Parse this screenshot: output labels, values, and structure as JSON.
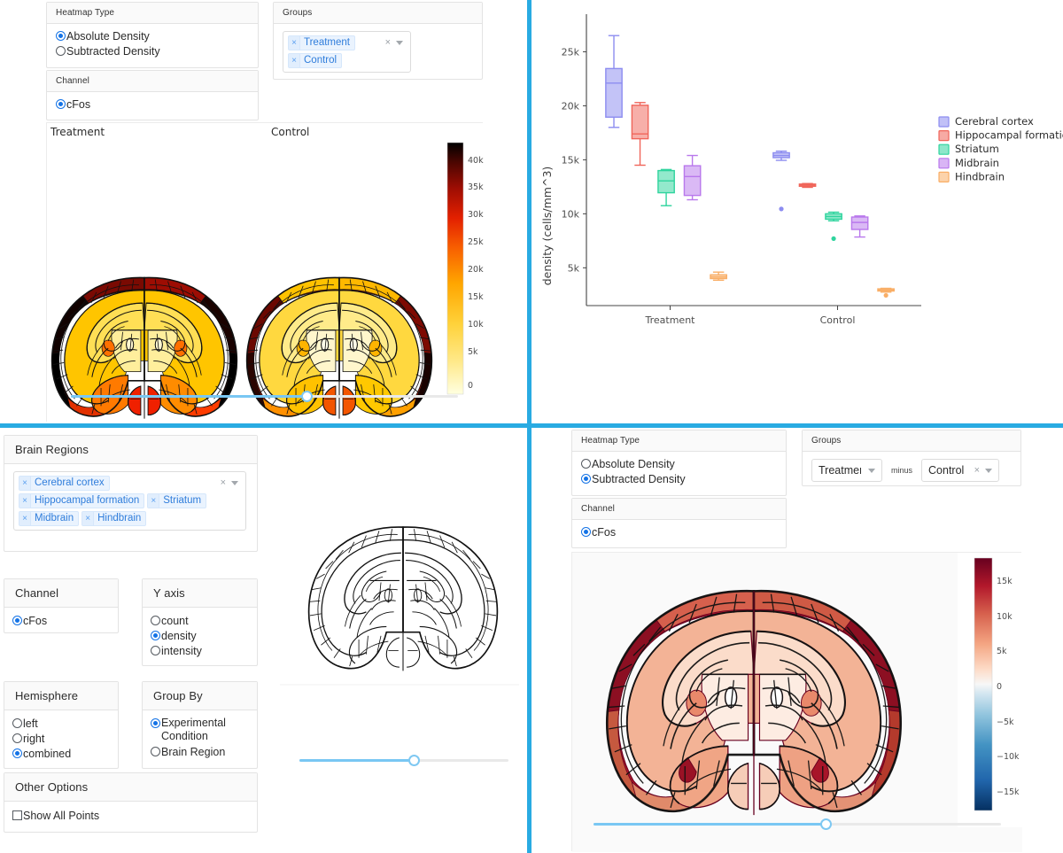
{
  "theme": {
    "divider_color": "#29abe2",
    "accent_blue": "#2f7ddb",
    "radio_on": "#1473e6",
    "slider_fill": "#79c7f3"
  },
  "panel_top_left": {
    "heatmap_type": {
      "header": "Heatmap Type",
      "options": [
        "Absolute Density",
        "Subtracted Density"
      ],
      "selected": "Absolute Density"
    },
    "channel": {
      "header": "Channel",
      "options": [
        "cFos"
      ],
      "selected": "cFos"
    },
    "groups": {
      "header": "Groups",
      "tokens": [
        "Treatment",
        "Control"
      ],
      "clear_glyph": "×",
      "token_remove_glyph": "×"
    },
    "brain_titles": [
      "Treatment",
      "Control"
    ],
    "colorbar": {
      "ticks": [
        "40k",
        "35k",
        "30k",
        "25k",
        "20k",
        "15k",
        "10k",
        "5k",
        "0"
      ],
      "colormap": "hot-reversed",
      "min": 0,
      "max": 45000
    },
    "slider": {
      "value_pct": 61
    }
  },
  "panel_top_right": {
    "chart_data": {
      "type": "box",
      "title": "",
      "xlabel": "",
      "ylabel": "density (cells/mm^3)",
      "ylim": [
        1500,
        27500
      ],
      "ytick_labels": [
        "5k",
        "10k",
        "15k",
        "20k",
        "25k"
      ],
      "ytick_values": [
        5000,
        10000,
        15000,
        20000,
        25000
      ],
      "categories": [
        "Treatment",
        "Control"
      ],
      "grid": false,
      "legend_position": "right",
      "legend": [
        {
          "name": "Cerebral cortex",
          "color": "#8c8cf0"
        },
        {
          "name": "Hippocampal formation",
          "color": "#f0655a"
        },
        {
          "name": "Striatum",
          "color": "#2fd49e"
        },
        {
          "name": "Midbrain",
          "color": "#b978ec"
        },
        {
          "name": "Hindbrain",
          "color": "#f9ae66"
        }
      ],
      "series": [
        {
          "name": "Cerebral cortex",
          "color": "#8c8cf0",
          "boxes": [
            {
              "group": "Treatment",
              "min": 18000,
              "q1": 18950,
              "median": 22100,
              "q3": 23450,
              "max": 26500,
              "outliers": []
            },
            {
              "group": "Control",
              "min": 14950,
              "q1": 15200,
              "median": 15400,
              "q3": 15650,
              "max": 15800,
              "outliers": [
                10450
              ]
            }
          ]
        },
        {
          "name": "Hippocampal formation",
          "color": "#f0655a",
          "boxes": [
            {
              "group": "Treatment",
              "min": 14500,
              "q1": 16950,
              "median": 17400,
              "q3": 20050,
              "max": 20300,
              "outliers": []
            },
            {
              "group": "Control",
              "min": 12450,
              "q1": 12550,
              "median": 12650,
              "q3": 12750,
              "max": 12800,
              "outliers": []
            }
          ]
        },
        {
          "name": "Striatum",
          "color": "#2fd49e",
          "boxes": [
            {
              "group": "Treatment",
              "min": 10750,
              "q1": 11950,
              "median": 13050,
              "q3": 14000,
              "max": 14100,
              "outliers": []
            },
            {
              "group": "Control",
              "min": 9350,
              "q1": 9500,
              "median": 9750,
              "q3": 10000,
              "max": 10150,
              "outliers": [
                7700
              ]
            }
          ]
        },
        {
          "name": "Midbrain",
          "color": "#b978ec",
          "boxes": [
            {
              "group": "Treatment",
              "min": 11300,
              "q1": 11700,
              "median": 13450,
              "q3": 14450,
              "max": 15400,
              "outliers": []
            },
            {
              "group": "Control",
              "min": 7850,
              "q1": 8550,
              "median": 9200,
              "q3": 9700,
              "max": 9800,
              "outliers": []
            }
          ]
        },
        {
          "name": "Hindbrain",
          "color": "#f9ae66",
          "boxes": [
            {
              "group": "Treatment",
              "min": 3850,
              "q1": 4000,
              "median": 4150,
              "q3": 4350,
              "max": 4600,
              "outliers": []
            },
            {
              "group": "Control",
              "min": 2750,
              "q1": 2850,
              "median": 2950,
              "q3": 3050,
              "max": 3100,
              "outliers": [
                2450
              ]
            }
          ]
        }
      ]
    }
  },
  "panel_bottom_left": {
    "brain_regions": {
      "header": "Brain Regions",
      "tokens": [
        "Cerebral cortex",
        "Hippocampal formation",
        "Striatum",
        "Midbrain",
        "Hindbrain"
      ],
      "clear_glyph": "×",
      "token_remove_glyph": "×"
    },
    "channel": {
      "header": "Channel",
      "options": [
        "cFos"
      ],
      "selected": "cFos"
    },
    "y_axis": {
      "header": "Y axis",
      "options": [
        "count",
        "density",
        "intensity"
      ],
      "selected": "density"
    },
    "hemisphere": {
      "header": "Hemisphere",
      "options": [
        "left",
        "right",
        "combined"
      ],
      "selected": "combined"
    },
    "group_by": {
      "header": "Group By",
      "options": [
        "Experimental Condition",
        "Brain Region"
      ],
      "selected": "Experimental Condition"
    },
    "other_options": {
      "header": "Other Options",
      "checkbox_label": "Show All Points",
      "checked": false
    },
    "slider": {
      "value_pct": 55
    }
  },
  "panel_bottom_right": {
    "heatmap_type": {
      "header": "Heatmap Type",
      "options": [
        "Absolute Density",
        "Subtracted Density"
      ],
      "selected": "Subtracted Density"
    },
    "channel": {
      "header": "Channel",
      "options": [
        "cFos"
      ],
      "selected": "cFos"
    },
    "groups": {
      "header": "Groups",
      "left_value": "Treatment",
      "operator": "minus",
      "right_value": "Control",
      "clear_glyph": "×",
      "caret_glyph": "▾"
    },
    "colorbar": {
      "ticks": [
        "15k",
        "10k",
        "5k",
        "0",
        "−5k",
        "−10k",
        "−15k"
      ],
      "colormap": "RdBu-reversed",
      "min": -18000,
      "max": 18000
    },
    "slider": {
      "value_pct": 57
    }
  }
}
